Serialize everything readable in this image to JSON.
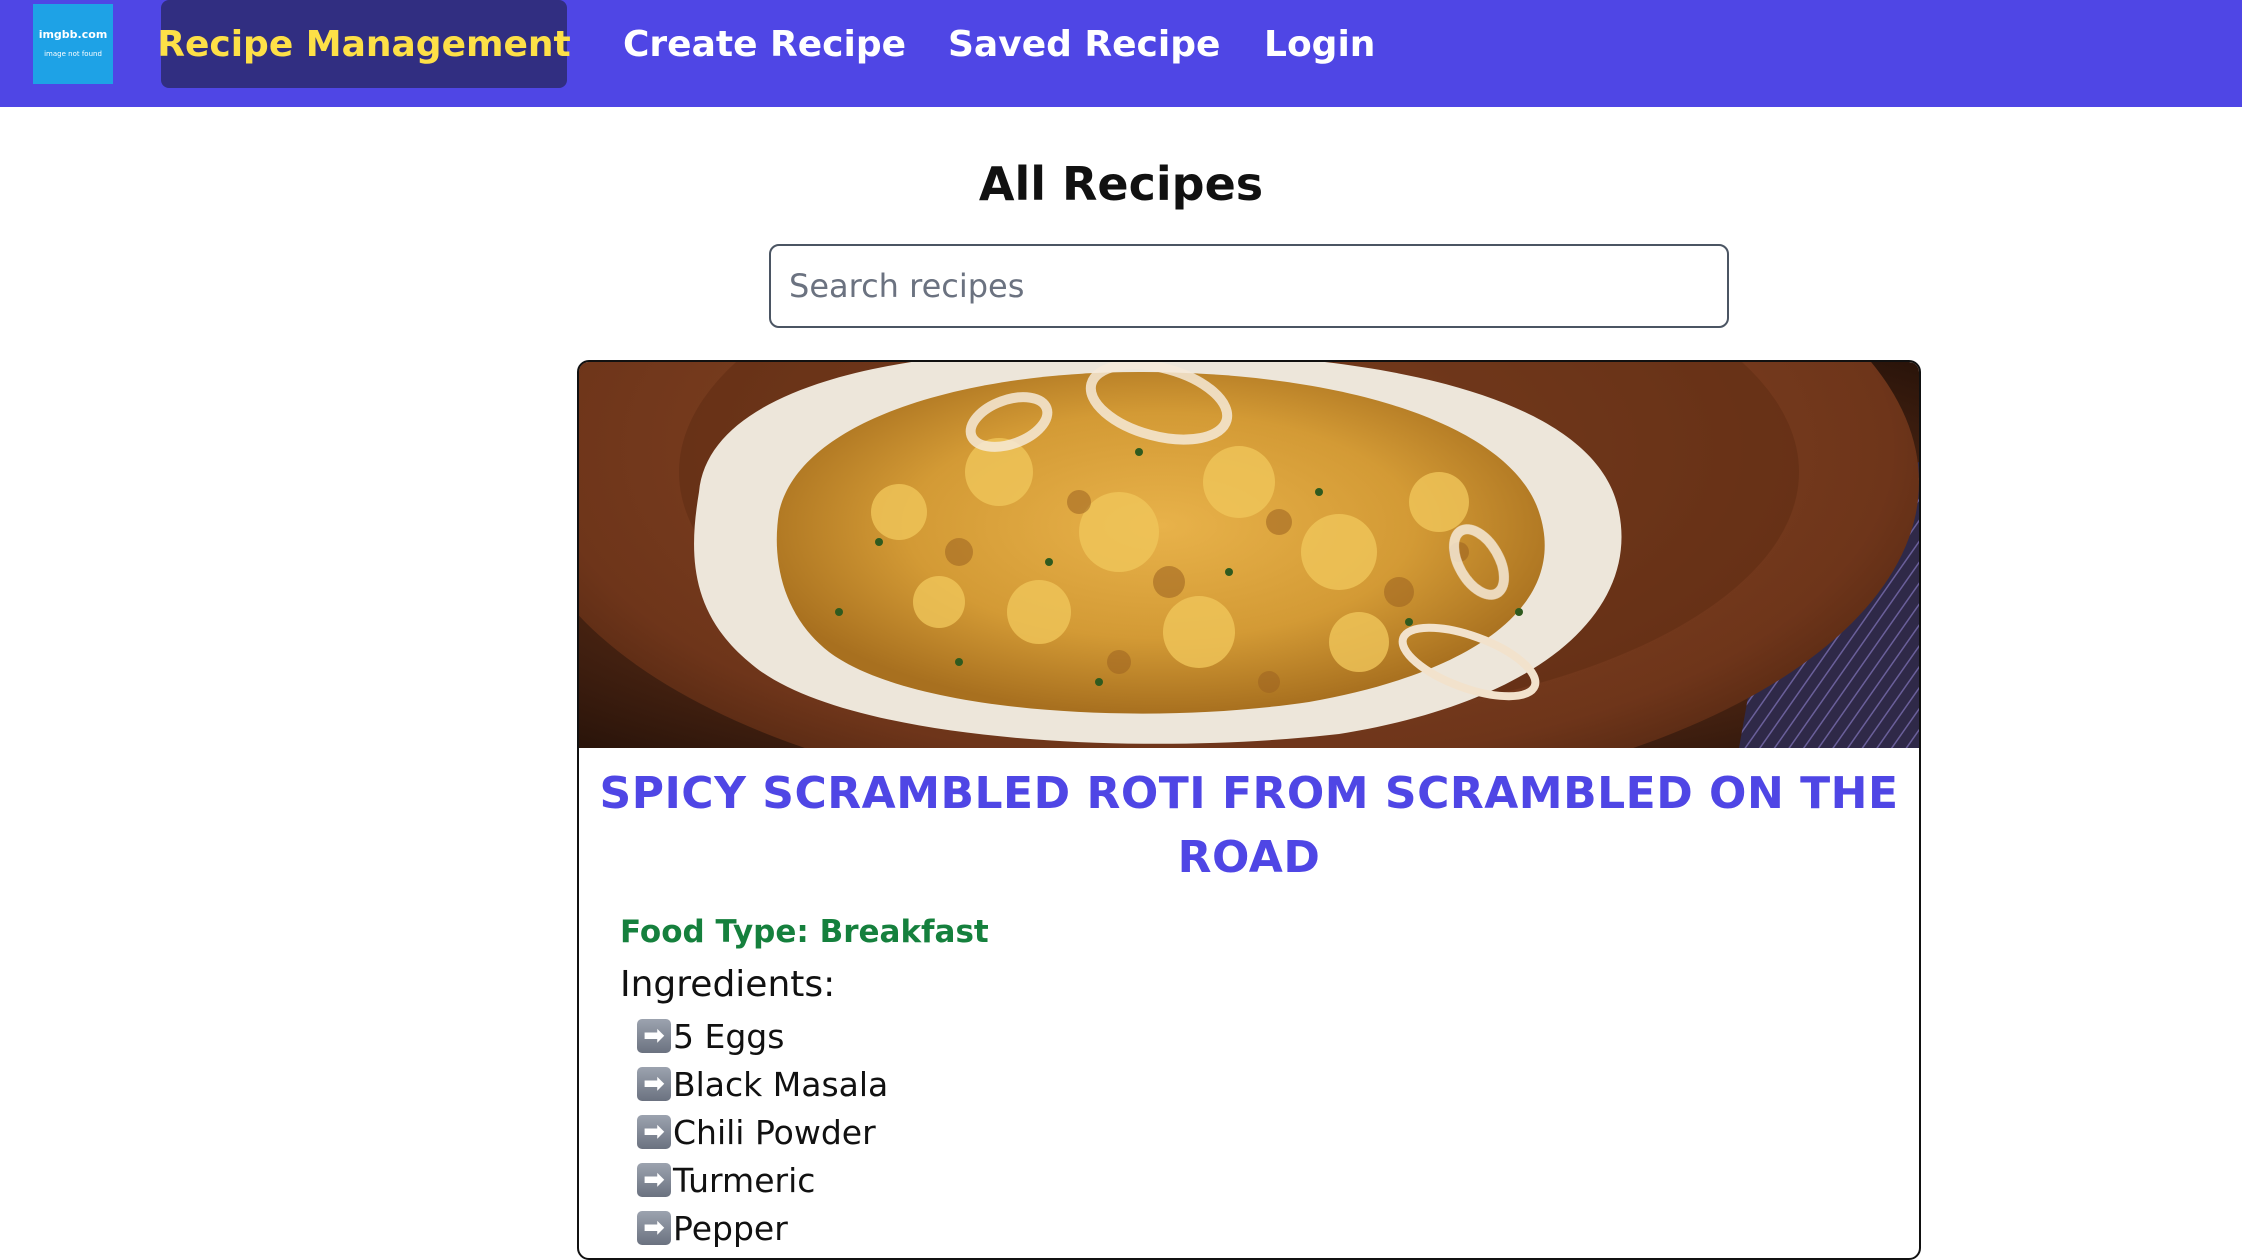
{
  "logo": {
    "site": "imgbb.com",
    "message": "image not found"
  },
  "nav": {
    "brand": "Recipe Management",
    "links": [
      "Create Recipe",
      "Saved Recipe",
      "Login"
    ]
  },
  "colors": {
    "navbar": "#4f46e5",
    "brand_background": "#312e81",
    "brand_text": "#fde047",
    "recipe_title": "#4f46e5",
    "food_type": "#15803d"
  },
  "page": {
    "title": "All Recipes"
  },
  "search": {
    "placeholder": "Search recipes",
    "value": ""
  },
  "recipe": {
    "image_subject": "scrambled egg roti served on a clay plate",
    "title": "SPICY SCRAMBLED ROTI FROM SCRAMBLED ON THE ROAD",
    "food_type": "Food Type: Breakfast",
    "ingredients_label": "Ingredients:",
    "ingredient_icon": "right-arrow-icon",
    "ingredient_arrow": "➡",
    "ingredients": [
      "5 Eggs",
      "Black Masala",
      "Chili Powder",
      "Turmeric",
      "Pepper"
    ]
  }
}
